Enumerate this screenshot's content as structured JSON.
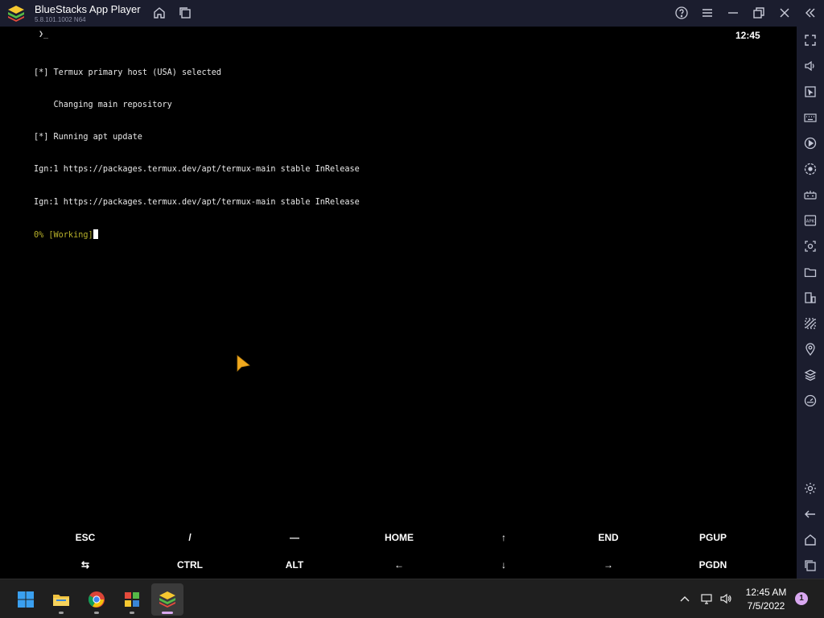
{
  "window": {
    "title": "BlueStacks App Player",
    "version": "5.8.101.1002 N64"
  },
  "status_bar": {
    "prompt": "❯_",
    "clock": "12:45"
  },
  "terminal": {
    "lines": [
      "[*] Termux primary host (USA) selected",
      "    Changing main repository",
      "[*] Running apt update",
      "Ign:1 https://packages.termux.dev/apt/termux-main stable InRelease",
      "Ign:1 https://packages.termux.dev/apt/termux-main stable InRelease"
    ],
    "progress": "0% [Working]"
  },
  "extra_keys": {
    "row1": [
      "ESC",
      "/",
      "—",
      "HOME",
      "↑",
      "END",
      "PGUP"
    ],
    "row2": [
      "⇆",
      "CTRL",
      "ALT",
      "←",
      "↓",
      "→",
      "PGDN"
    ]
  },
  "taskbar": {
    "time": "12:45 AM",
    "date": "7/5/2022",
    "notification_count": "1"
  }
}
